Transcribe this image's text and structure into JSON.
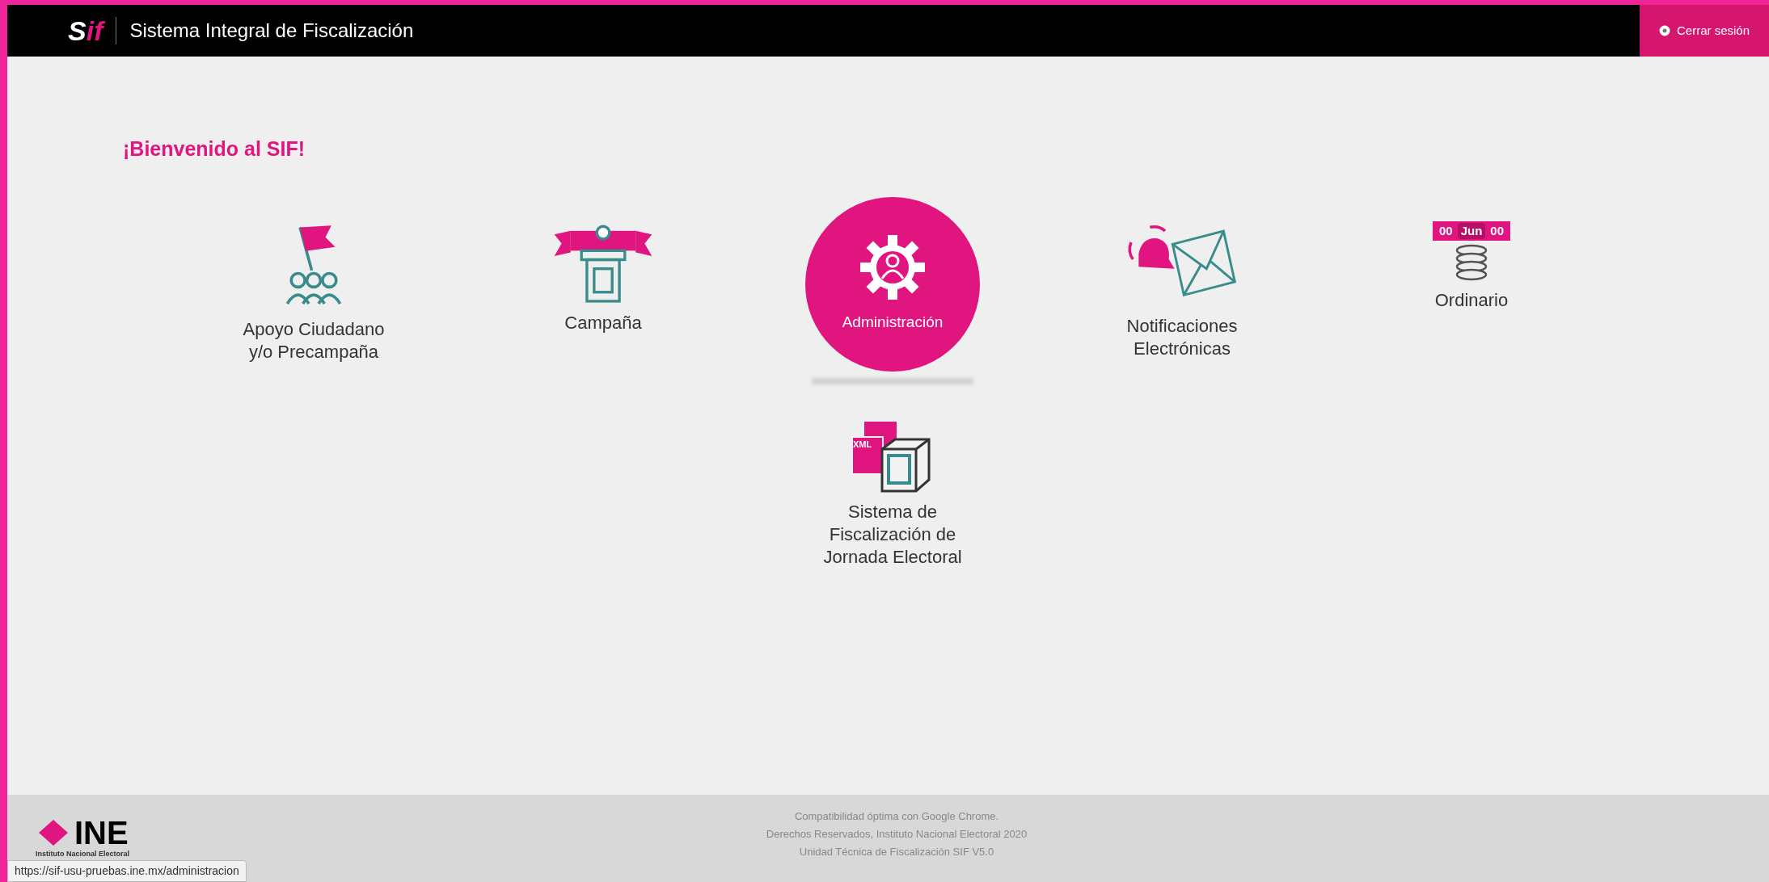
{
  "header": {
    "logo": {
      "left": "S",
      "right": "if"
    },
    "title": "Sistema Integral de Fiscalización",
    "logout": "Cerrar sesión"
  },
  "welcome": "¡Bienvenido al SIF!",
  "modules": [
    {
      "kind": "apoyo",
      "label": "Apoyo Ciudadano y/o Precampaña",
      "selected": false
    },
    {
      "kind": "campana",
      "label": "Campaña",
      "selected": false
    },
    {
      "kind": "admin",
      "label": "Administración",
      "selected": true
    },
    {
      "kind": "notificaciones",
      "label": "Notificaciones Electrónicas",
      "selected": false
    },
    {
      "kind": "ordinario",
      "label": "Ordinario",
      "selected": false,
      "badge": [
        "00",
        "Jun",
        "00"
      ]
    },
    {
      "kind": "jornada",
      "label": "Sistema de Fiscalización de Jornada Electoral",
      "selected": false,
      "badge": [
        "XML"
      ]
    }
  ],
  "footer": {
    "logo": {
      "name": "INE",
      "subtitle": "Instituto Nacional Electoral"
    },
    "lines": [
      "Compatibilidad óptima con Google Chrome.",
      "Derechos Reservados, Instituto Nacional Electoral 2020",
      "Unidad Técnica de Fiscalización SIF V5.0"
    ]
  },
  "status_url": "https://sif-usu-pruebas.ine.mx/administracion"
}
